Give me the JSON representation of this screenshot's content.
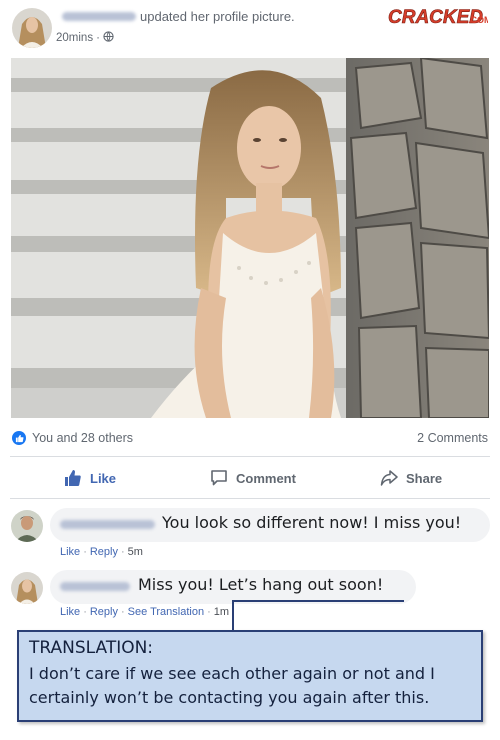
{
  "post": {
    "action": "updated her profile picture.",
    "time": "20mins",
    "privacy_icon": "globe-icon"
  },
  "brand": {
    "logo_text": "CRACKED",
    "logo_suffix": ".COM",
    "logo_color": "#d63d2a"
  },
  "reactions": {
    "summary": "You and 28 others",
    "comments_count": "2 Comments"
  },
  "actions": {
    "like": "Like",
    "comment": "Comment",
    "share": "Share"
  },
  "comments": [
    {
      "text": "You look so different now! I miss you!",
      "actions": [
        "Like",
        "Reply"
      ],
      "time": "5m"
    },
    {
      "text": "Miss you! Let’s hang out soon!",
      "actions": [
        "Like",
        "Reply",
        "See Translation"
      ],
      "time": "1m"
    }
  ],
  "translation": {
    "title": "TRANSLATION:",
    "line1": "I don’t care if we see each other again or not and I",
    "line2": "certainly won’t be contacting you again after this."
  },
  "colors": {
    "accent": "#4267b2",
    "like_blue": "#1877f2",
    "translation_bg": "#c6d8ef",
    "translation_border": "#2a3f75"
  }
}
